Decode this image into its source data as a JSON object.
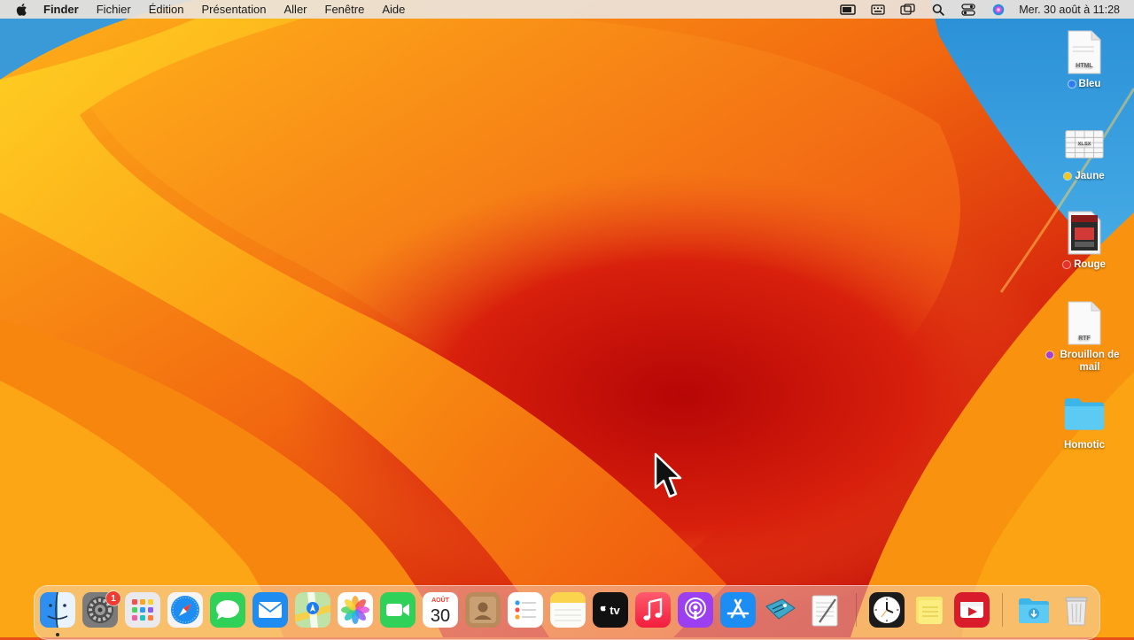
{
  "menubar": {
    "apple_icon": "apple-logo-icon",
    "items": [
      "Finder",
      "Fichier",
      "Édition",
      "Présentation",
      "Aller",
      "Fenêtre",
      "Aide"
    ],
    "status_icons": [
      "screen-mirroring-icon",
      "keyboard-icon",
      "windows-icon",
      "spotlight-search-icon",
      "control-center-icon",
      "siri-icon"
    ],
    "clock": "Mer. 30 août à 11:28"
  },
  "desktop": {
    "items": [
      {
        "label": "Bleu",
        "tag_color": "#2f7cf6",
        "icon": "html-file-icon",
        "doc_text": "HTML"
      },
      {
        "label": "Jaune",
        "tag_color": "#f5c518",
        "icon": "xlsx-file-icon",
        "doc_text": "XLSX"
      },
      {
        "label": "Rouge",
        "tag_color": "#e8302a",
        "icon": "image-file-icon"
      },
      {
        "label": "Brouillon de mail",
        "tag_color": "#a53fd6",
        "icon": "rtf-file-icon",
        "doc_text": "RTF"
      },
      {
        "label": "Homotic",
        "icon": "folder-icon"
      }
    ]
  },
  "dock": {
    "apps": [
      {
        "name": "finder-icon"
      },
      {
        "name": "system-settings-icon",
        "badge": "1"
      },
      {
        "name": "launchpad-icon"
      },
      {
        "name": "safari-icon"
      },
      {
        "name": "messages-icon"
      },
      {
        "name": "mail-icon"
      },
      {
        "name": "maps-icon"
      },
      {
        "name": "photos-icon"
      },
      {
        "name": "facetime-icon"
      },
      {
        "name": "calendar-icon",
        "month": "AOÛT",
        "day": "30"
      },
      {
        "name": "contacts-icon"
      },
      {
        "name": "reminders-icon"
      },
      {
        "name": "notes-icon"
      },
      {
        "name": "apple-tv-icon",
        "text": "tv"
      },
      {
        "name": "music-icon"
      },
      {
        "name": "podcasts-icon"
      },
      {
        "name": "app-store-icon"
      },
      {
        "name": "numbers-tag-icon"
      },
      {
        "name": "textedit-icon"
      },
      {
        "name": "clock-icon"
      },
      {
        "name": "stickies-icon"
      },
      {
        "name": "photo-booth-icon"
      },
      {
        "name": "downloads-folder-icon"
      },
      {
        "name": "trash-icon"
      }
    ]
  },
  "colors": {
    "wallpaper_orange": "#f27a12",
    "wallpaper_red": "#c00e0e",
    "wallpaper_yellow": "#ffc21a",
    "wallpaper_blue": "#2a8fd6"
  }
}
